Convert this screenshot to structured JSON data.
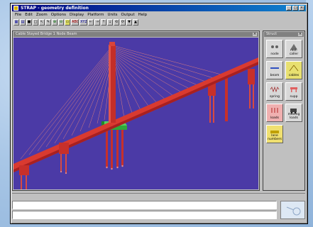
{
  "window": {
    "title": "STRAP - geometry definition",
    "buttons": [
      "_",
      "□",
      "×"
    ]
  },
  "menu": [
    "File",
    "Edit",
    "Zoom",
    "Options",
    "Display",
    "Platform",
    "Units",
    "Output",
    "Help"
  ],
  "toolbar": [
    {
      "label": "▦",
      "icon": "grid-icon"
    },
    {
      "label": "▤",
      "icon": "table-icon"
    },
    {
      "label": "■",
      "icon": "stop-icon"
    },
    {
      "label": "□",
      "icon": "frame-icon"
    },
    {
      "label": "↖",
      "icon": "pointer-icon"
    },
    {
      "label": "✎",
      "icon": "pencil-icon"
    },
    {
      "label": "⊕",
      "icon": "zoom-in-icon"
    },
    {
      "label": "⊖",
      "icon": "zoom-out-icon"
    },
    {
      "label": "▭",
      "icon": "window-icon"
    },
    {
      "label": "ABC",
      "icon": "text-icon"
    },
    {
      "label": "XYZ",
      "icon": "axes-icon"
    },
    {
      "label": "⇠",
      "icon": "rotate-left-icon"
    },
    {
      "label": "⇢",
      "icon": "rotate-right-icon"
    },
    {
      "label": "⇡",
      "icon": "rotate-up-icon"
    },
    {
      "label": "⇣",
      "icon": "rotate-down-icon"
    },
    {
      "label": "⟲",
      "icon": "spin-left-icon"
    },
    {
      "label": "⟳",
      "icon": "spin-right-icon"
    },
    {
      "label": "▼",
      "icon": "view-down-icon"
    },
    {
      "label": "▲",
      "icon": "view-up-icon"
    }
  ],
  "child_window": {
    "title": "Cable Stayed Bridge    1    Node    Beam",
    "close": "×"
  },
  "palette": {
    "title": "Struct",
    "close": "×",
    "items": [
      {
        "label": "node",
        "icon": "node-icon"
      },
      {
        "label": "rest. caller",
        "icon": "restraint-icon"
      },
      {
        "label": "beam",
        "icon": "beam-icon"
      },
      {
        "label": "cables",
        "icon": "cables-icon"
      },
      {
        "label": "spring",
        "icon": "spring-icon"
      },
      {
        "label": "supp",
        "icon": "support-icon"
      },
      {
        "label": "loads",
        "icon": "loads-icon"
      },
      {
        "label": "moving loads",
        "icon": "moving-loads-icon"
      },
      {
        "label": "lane numbers",
        "icon": "lane-numbers-icon"
      }
    ]
  },
  "command_lines": [
    "",
    ""
  ],
  "colors": {
    "viewport_bg": "#4b3aa6",
    "deck": "#d93a30",
    "deck_shadow": "#a82020",
    "cables": "#e87a70",
    "pylon": "#c0302a",
    "pile_cap": "#2fa83a",
    "title_bar": "#000080"
  }
}
